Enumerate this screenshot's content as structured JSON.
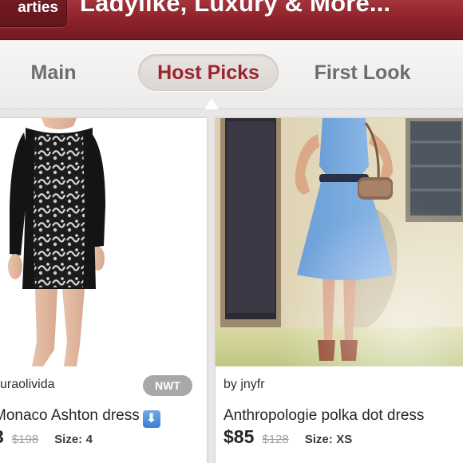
{
  "header": {
    "back_label": "arties",
    "title": "Ladylike, Luxury & More..."
  },
  "tabs": [
    {
      "label": "Main",
      "active": false
    },
    {
      "label": "Host Picks",
      "active": true
    },
    {
      "label": "First Look",
      "active": false
    }
  ],
  "listings": [
    {
      "seller": "uraolivida",
      "badge": "NWT",
      "title": " Monaco Ashton dress",
      "icon": "info-arrow-icon",
      "price": "3",
      "original_price": "$198",
      "size_label": "Size:",
      "size": "4"
    },
    {
      "seller": "by jnyfr",
      "title": "Anthropologie polka dot dress",
      "price": "$85",
      "original_price": "$128",
      "size_label": "Size:",
      "size": "XS"
    }
  ],
  "colors": {
    "brand": "#8b2129",
    "active_tab": "#9a2530",
    "badge": "#a8a8a8"
  }
}
